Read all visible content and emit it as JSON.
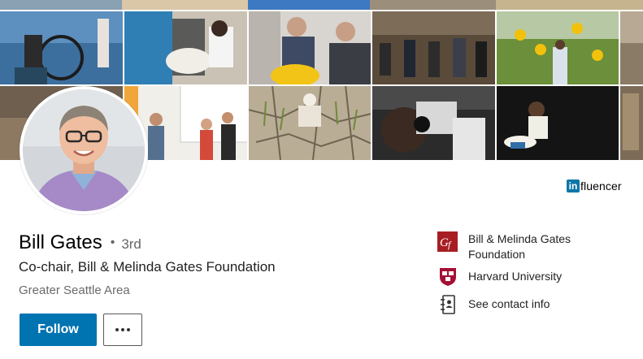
{
  "badge": {
    "in_label": "in",
    "text": "fluencer"
  },
  "profile": {
    "name": "Bill Gates",
    "degree_separator": "•",
    "degree": "3rd",
    "headline": "Co-chair, Bill & Melinda Gates Foundation",
    "location": "Greater Seattle Area"
  },
  "actions": {
    "follow_label": "Follow"
  },
  "right_column": {
    "foundation_line1": "Bill & Melinda Gates",
    "foundation_line2": "Foundation",
    "education": "Harvard University",
    "contact": "See contact info"
  },
  "colors": {
    "follow_bg": "#0073b1",
    "linkedin_blue": "#0e76a8",
    "foundation_red": "#a61e22",
    "harvard_crimson": "#a41034"
  }
}
